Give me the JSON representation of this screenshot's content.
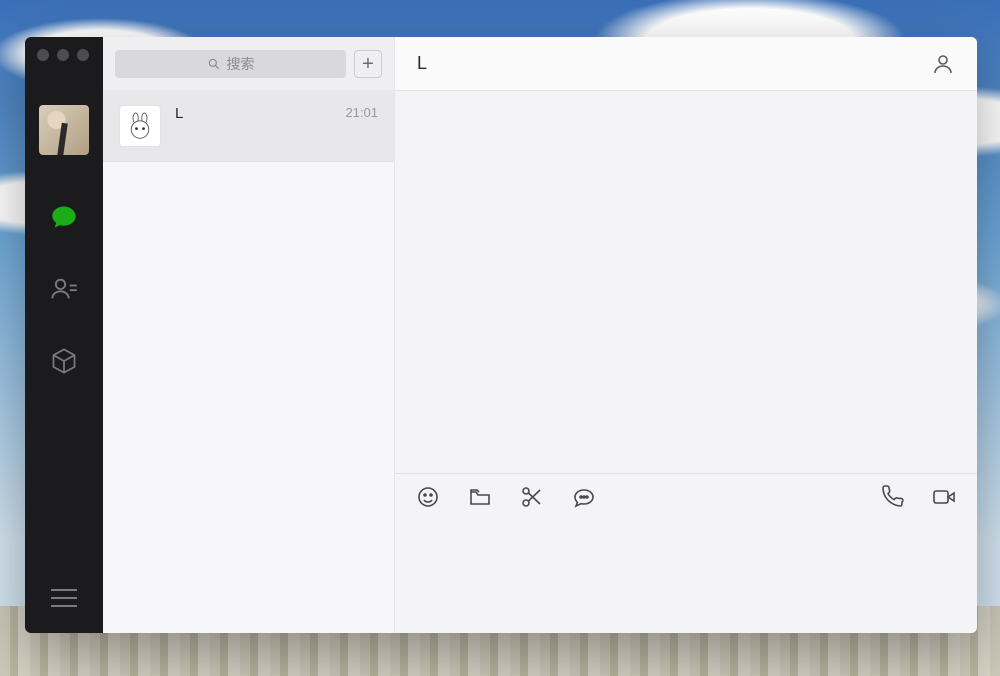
{
  "search": {
    "placeholder": "搜索"
  },
  "add_button_label": "+",
  "sidebar": {
    "nav": [
      {
        "id": "chats",
        "active": true
      },
      {
        "id": "contacts",
        "active": false
      },
      {
        "id": "box",
        "active": false
      }
    ]
  },
  "conversations": [
    {
      "name": "L",
      "time": "21:01",
      "avatar": "bunny"
    }
  ],
  "chat": {
    "title": "L"
  },
  "toolbar_icons": {
    "emoji": "emoji-icon",
    "folder": "folder-icon",
    "scissors": "scissors-icon",
    "more": "chat-bubble-icon",
    "phone": "phone-icon",
    "video": "video-icon"
  },
  "header_icon": "person-icon"
}
